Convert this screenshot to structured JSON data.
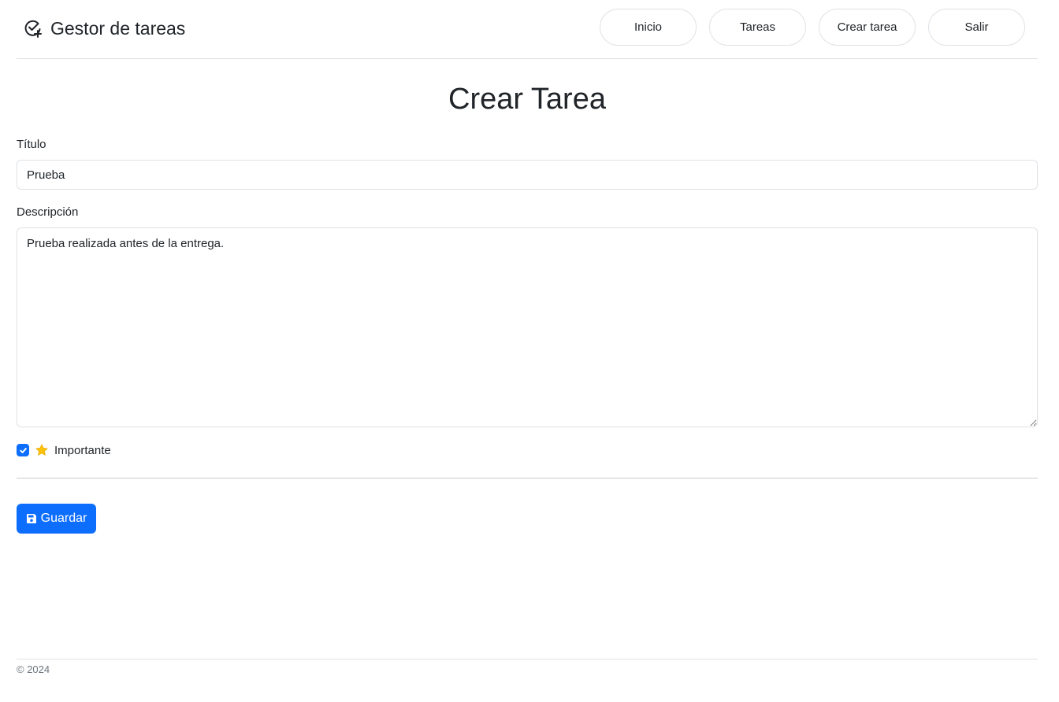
{
  "navbar": {
    "brand": "Gestor de tareas",
    "brand_icon": "check-circle-plus-icon",
    "links": [
      {
        "label": "Inicio"
      },
      {
        "label": "Tareas"
      },
      {
        "label": "Crear tarea"
      },
      {
        "label": "Salir"
      }
    ]
  },
  "page": {
    "title": "Crear Tarea"
  },
  "form": {
    "title_label": "Título",
    "title_value": "Prueba",
    "description_label": "Descripción",
    "description_value": "Prueba realizada antes de la entrega.",
    "important_label": "Importante",
    "important_checked": true,
    "important_icon": "star-icon",
    "save_label": "Guardar",
    "save_icon": "floppy-disk-icon"
  },
  "colors": {
    "primary": "#0d6efd",
    "star": "#ffc107",
    "text": "#212529",
    "muted": "#6c757d",
    "border": "#dee2e6"
  },
  "footer": {
    "text": "© 2024"
  }
}
